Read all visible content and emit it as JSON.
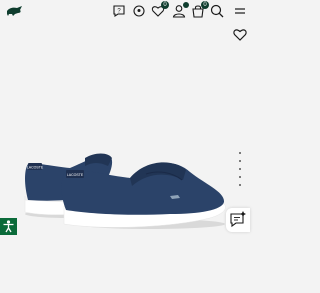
{
  "header": {
    "logo_icon": "crocodile-logo-icon",
    "icons": {
      "help": "help-icon",
      "store_locator": "location-pin-icon",
      "wishlist": "heart-icon",
      "account": "user-icon",
      "cart": "bag-icon",
      "search": "search-icon",
      "menu": "menu-icon"
    },
    "wishlist_count": "0",
    "cart_count": "0"
  },
  "product": {
    "image_subject": "navy suede loafers",
    "add_to_wishlist_icon": "heart-outline-icon",
    "heel_tab_text": "LACOSTE"
  },
  "gallery": {
    "dot_count": 5
  },
  "colors": {
    "brand_green": "#0f3d2e",
    "accessibility_green": "#0b6b3a",
    "shoe_navy": "#2b4369",
    "background": "#f3f3f3"
  }
}
